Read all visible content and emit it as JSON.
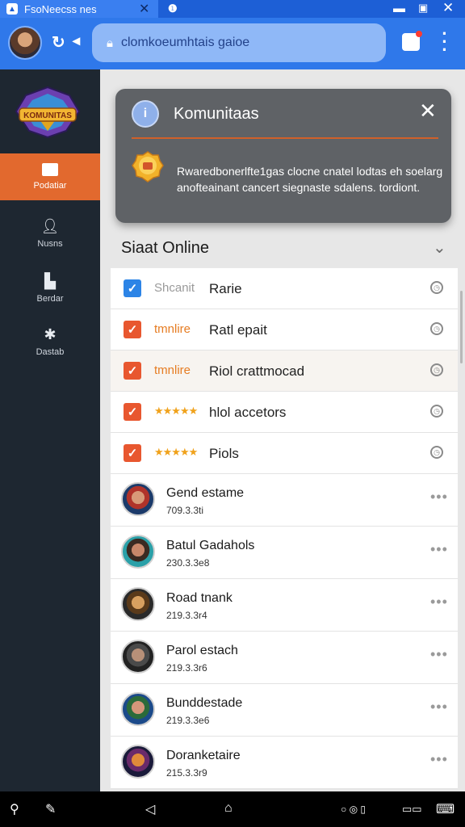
{
  "browser": {
    "tab_title": "FsoNeecss nes",
    "address": "clomkoeumhtais gaioe"
  },
  "sidebar": {
    "items": [
      {
        "label": "Podatiar",
        "icon": "folder-icon"
      },
      {
        "label": "Nusns",
        "icon": "user-icon"
      },
      {
        "label": "Berdar",
        "icon": "document-icon"
      },
      {
        "label": "Dastab",
        "icon": "settings-icon"
      }
    ],
    "logo_text": "KOMUNITAS"
  },
  "notification": {
    "title": "Komunitaas",
    "body": "Rwaredbonerlfte1gas clocne cnatel lodtas eh soelarg anofteainant cancert siegnaste sdalens. tordiont."
  },
  "section": {
    "title": "Siaat Online"
  },
  "tasks": [
    {
      "tag": "Shcanit",
      "tag_style": "gray",
      "label": "Rarie",
      "checkbox": "blue"
    },
    {
      "tag": "tmnlire",
      "tag_style": "orange",
      "label": "Ratl epait",
      "checkbox": "orange"
    },
    {
      "tag": "tmnlire",
      "tag_style": "orange",
      "label": "Riol crattmocad",
      "checkbox": "orange"
    },
    {
      "tag": "★★★★★",
      "tag_style": "stars",
      "label": "hlol accetors",
      "checkbox": "orange"
    },
    {
      "tag": "★★★★★",
      "tag_style": "stars",
      "label": "Piols",
      "checkbox": "orange"
    }
  ],
  "players": [
    {
      "name": "Gend estame",
      "id": "709.3.3ti"
    },
    {
      "name": "Batul Gadahols",
      "id": "230.3.3e8"
    },
    {
      "name": "Road tnank",
      "id": "219.3.3r4"
    },
    {
      "name": "Parol estach",
      "id": "219.3.3r6"
    },
    {
      "name": "Bunddestade",
      "id": "219.3.3e6"
    },
    {
      "name": "Doranketaire",
      "id": "215.3.3r9"
    }
  ],
  "colors": {
    "accent_orange": "#e2692e",
    "browser_blue": "#2f78ea",
    "sidebar_bg": "#1e2731"
  }
}
